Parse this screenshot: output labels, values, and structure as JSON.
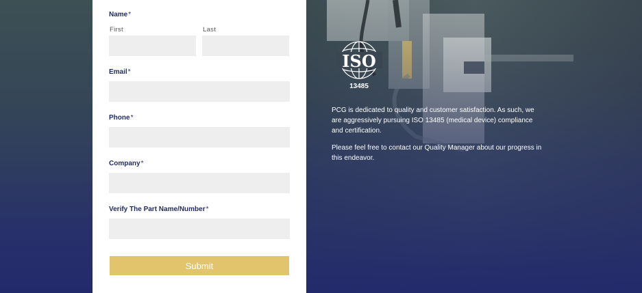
{
  "form": {
    "name_label": "Name",
    "first_label": "First",
    "last_label": "Last",
    "email_label": "Email",
    "phone_label": "Phone",
    "company_label": "Company",
    "part_label": "Verify The Part Name/Number",
    "required_mark": "*",
    "first_value": "",
    "last_value": "",
    "email_value": "",
    "phone_value": "",
    "company_value": "",
    "part_value": "",
    "submit_label": "Submit"
  },
  "info": {
    "logo_text": "ISO",
    "logo_number": "13485",
    "paragraph1": "PCG is dedicated to quality and customer satisfaction. As such, we are aggressively pursuing ISO 13485 (medical device) compliance and certification.",
    "paragraph2": "Please feel free to contact our Quality Manager about our progress in this endeavor."
  },
  "colors": {
    "accent": "#e2c46d",
    "label": "#1f2a5e",
    "field_bg": "#eeeeee",
    "background_bottom": "#232a6c"
  }
}
